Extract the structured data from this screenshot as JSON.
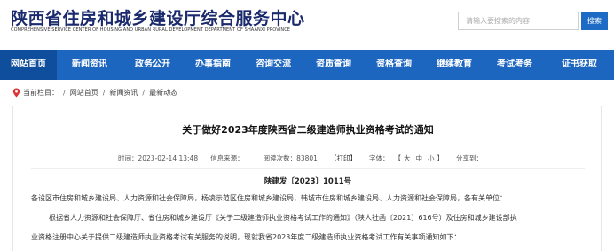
{
  "header": {
    "site_title": "陕西省住房和城乡建设厅综合服务中心",
    "site_subtitle_en": "COMPREHENSIVE SERVICE CENTER OF HOUSING AND URBAN RURAL DEVELOPMENT DEPARTMENT OF SHAANXI PROVINCE",
    "search_placeholder": "请输入要搜索的内容",
    "search_button": "搜索"
  },
  "nav": {
    "items": [
      {
        "label": "网站首页",
        "active": true
      },
      {
        "label": "新闻资讯",
        "active": false
      },
      {
        "label": "政务公开",
        "active": false
      },
      {
        "label": "办事指南",
        "active": false
      },
      {
        "label": "咨询交流",
        "active": false
      },
      {
        "label": "资质查询",
        "active": false
      },
      {
        "label": "资格查询",
        "active": false
      },
      {
        "label": "继续教育",
        "active": false
      },
      {
        "label": "考试考务",
        "active": false
      },
      {
        "label": "证书获取",
        "active": false
      }
    ]
  },
  "breadcrumb": {
    "prefix": "当前栏目：",
    "items": [
      "网站首页",
      "新闻资讯",
      "最新动态"
    ]
  },
  "article": {
    "title": "关于做好2023年度陕西省二级建造师执业资格考试的通知",
    "meta": {
      "time_label": "时间：",
      "time_value": "2023-02-14 13:48",
      "source_label": "信息来源：",
      "views_label": "阅读次数：",
      "views_value": "83801",
      "print_label": "【打印】",
      "font_label": "字体：",
      "font_open": "【",
      "font_large": "大",
      "font_medium": "中",
      "font_small": "小",
      "font_close": "】",
      "share_label": "分享到："
    },
    "doc_number": "陕建发〔2023〕1011号",
    "recipients": "各设区市住房和城乡建设局、人力资源和社会保障局，杨凌示范区住房和城乡建设局，韩城市住房和城乡建设局、人力资源和社会保障局，各有关单位：",
    "paragraph_line1": "根据省人力资源和社会保障厅、省住房和城乡建设厅《关于二级建造师执业资格考试工作的通知》（陕人社函〔2021〕616号）及住房和城乡建设部执",
    "paragraph_line2": "业资格注册中心关于提供二级建造师执业资格考试有关服务的说明，现就我省2023年度二级建造师执业资格考试工作有关事项通知如下："
  },
  "colors": {
    "nav_bg": "#1d66c0",
    "nav_active_bg": "#0f4e9c",
    "title_color": "#1a2a6c",
    "search_button_bg": "#1e6bc6"
  }
}
